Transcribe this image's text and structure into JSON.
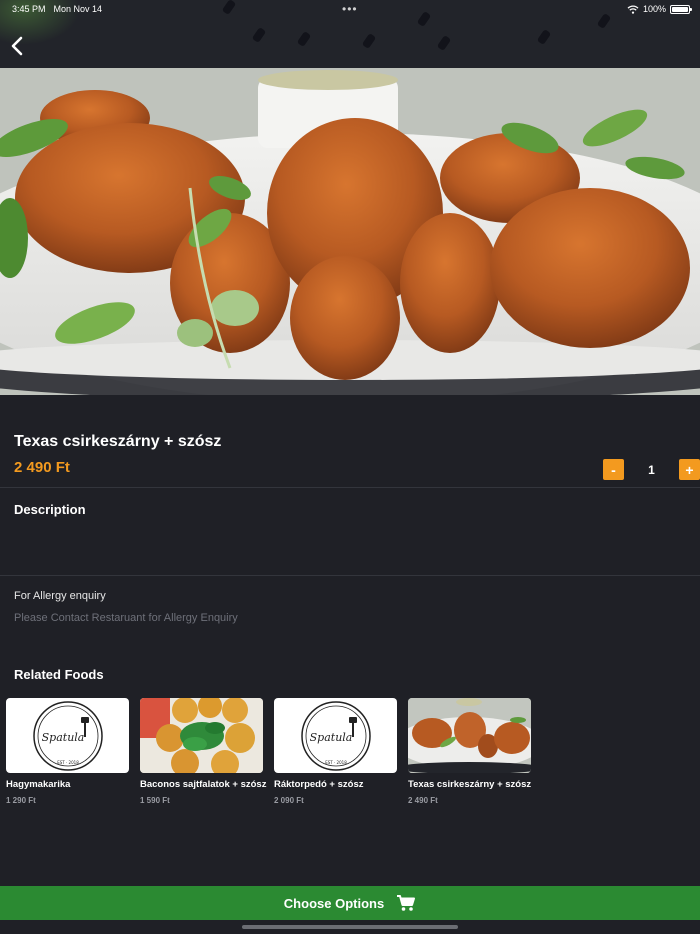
{
  "status_bar": {
    "time": "3:45 PM",
    "date": "Mon Nov 14",
    "battery": "100%",
    "dots": "•••"
  },
  "product": {
    "title": "Texas csirkeszárny + szósz",
    "price": "2 490 Ft",
    "quantity": "1",
    "minus_label": "-",
    "plus_label": "+"
  },
  "description": {
    "heading": "Description"
  },
  "allergy": {
    "heading": "For Allergy enquiry",
    "text": "Please Contact Restaruant for Allergy Enquiry"
  },
  "related": {
    "heading": "Related Foods",
    "items": [
      {
        "name": "Hagymakarika",
        "price": "1 290 Ft",
        "image": "spatula-logo"
      },
      {
        "name": "Baconos sajtfalatok + szósz",
        "price": "1 590 Ft",
        "image": "cheese-bites-photo"
      },
      {
        "name": "Ráktorpedó + szósz",
        "price": "2 090 Ft",
        "image": "spatula-logo"
      },
      {
        "name": "Texas csirkeszárny + szósz",
        "price": "2 490 Ft",
        "image": "chicken-wings-photo"
      }
    ],
    "logo_text": "Spatula",
    "logo_est": "EST · 2018"
  },
  "cta": {
    "label": "Choose Options",
    "icon": "cart-icon"
  },
  "colors": {
    "accent": "#f39a1f",
    "cta": "#2b8a32",
    "background": "#1f2026"
  }
}
